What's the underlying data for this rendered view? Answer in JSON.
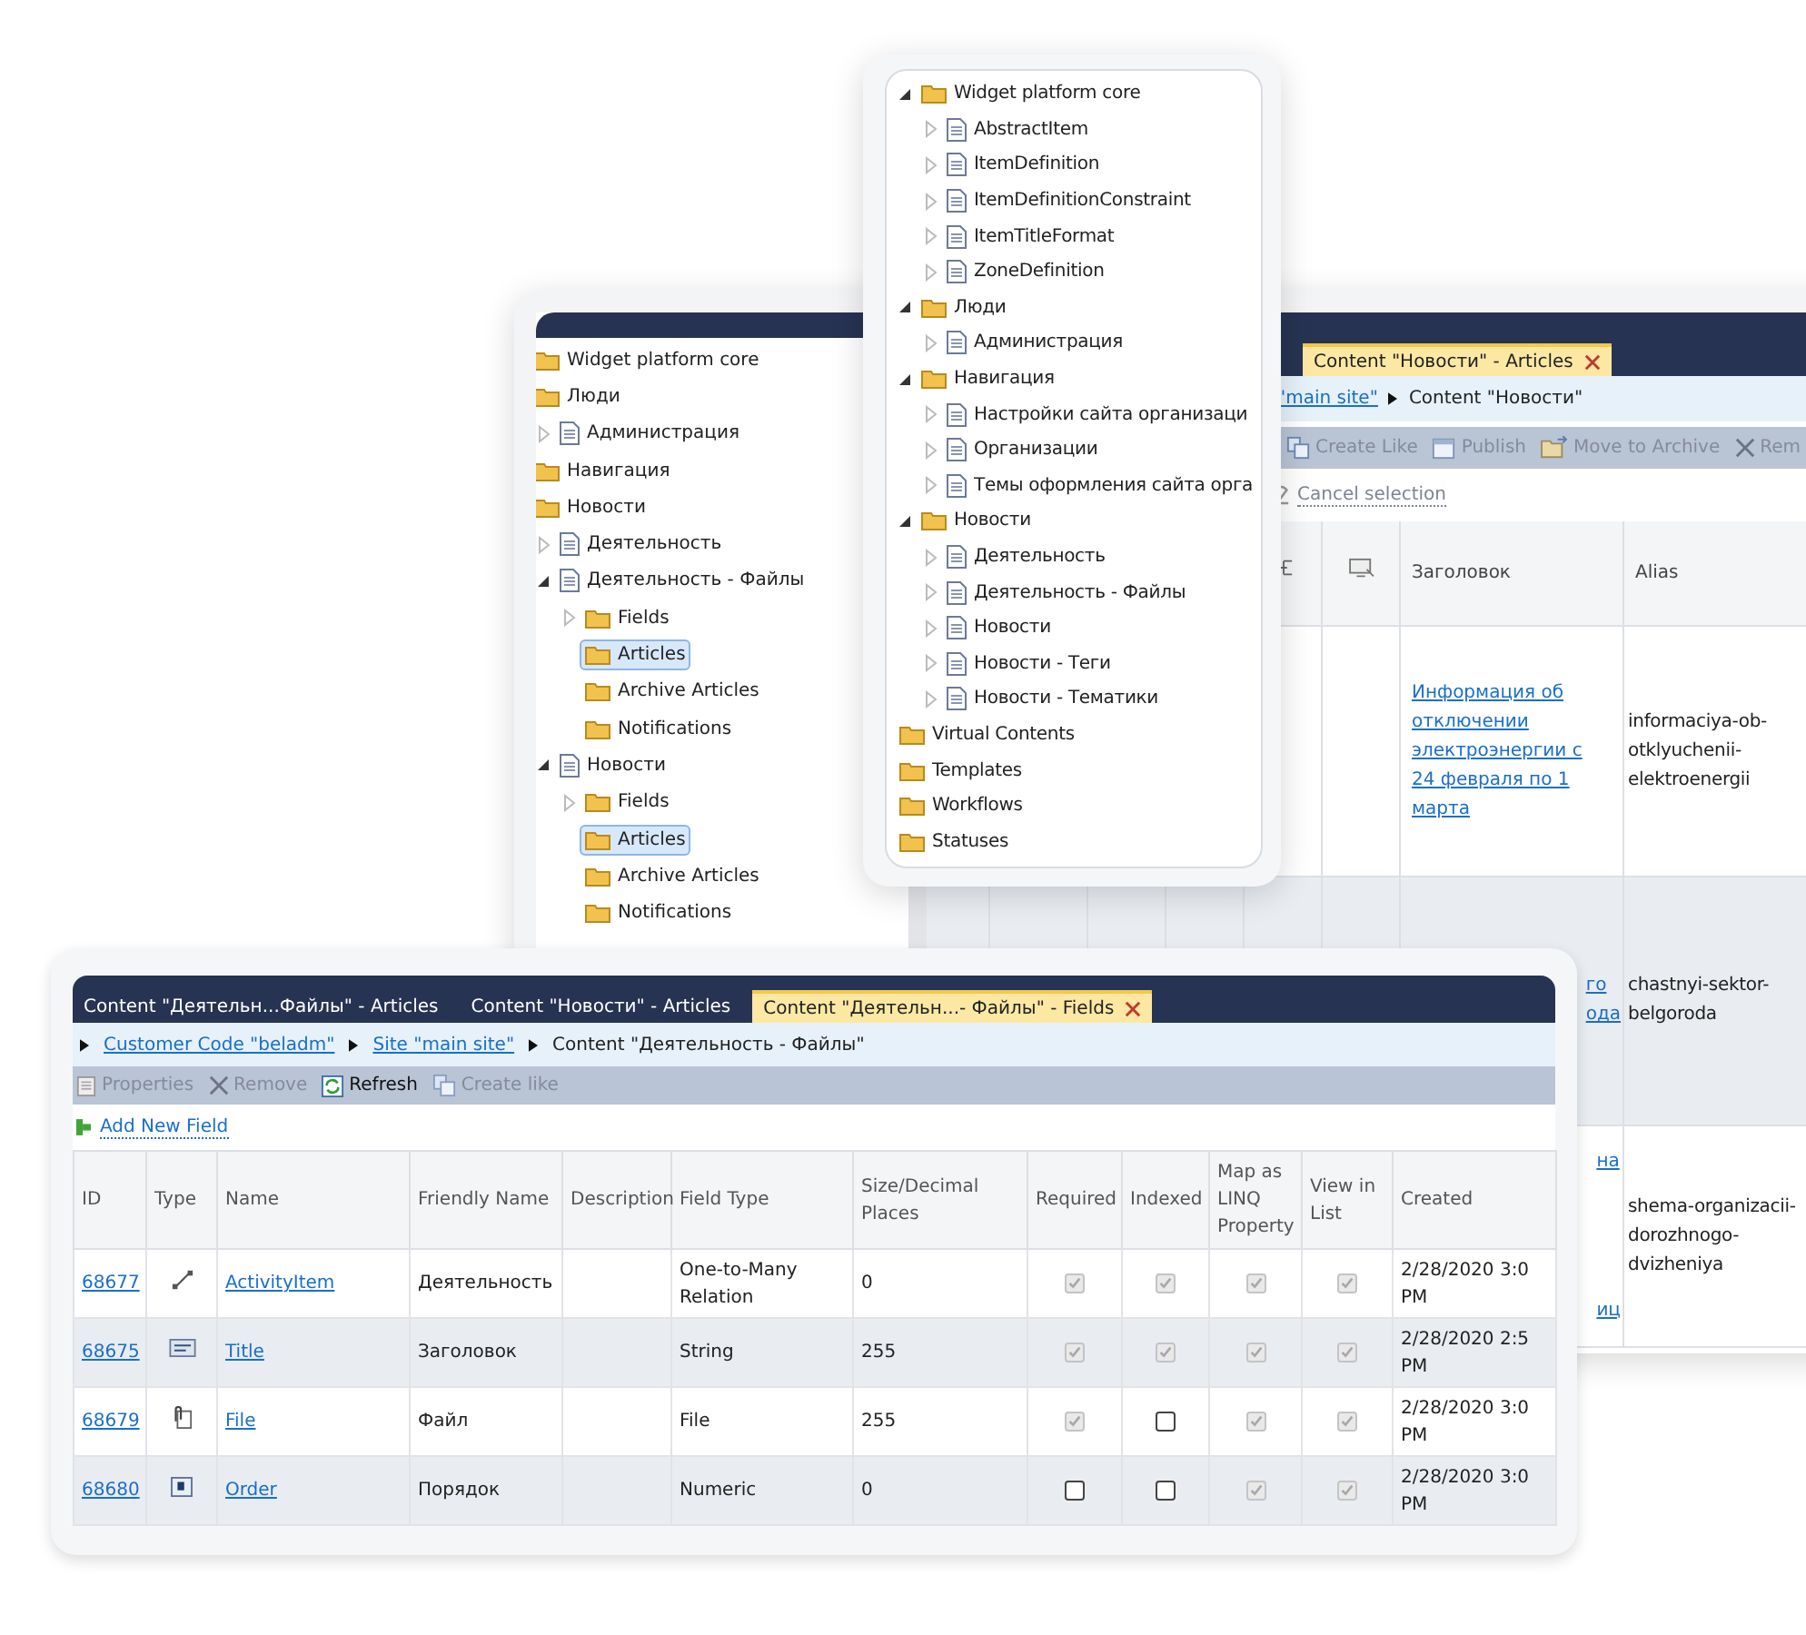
{
  "back_window": {
    "tree": [
      {
        "label": "Widget platform core",
        "kind": "folder",
        "selected": false
      },
      {
        "label": "Люди",
        "kind": "folder",
        "selected": false,
        "children": [
          {
            "label": "Администрация",
            "kind": "doc",
            "expanded": false,
            "selected": false
          }
        ]
      },
      {
        "label": "Навигация",
        "kind": "folder",
        "selected": false
      },
      {
        "label": "Новости",
        "kind": "folder",
        "selected": false,
        "children": [
          {
            "label": "Деятельность",
            "kind": "doc",
            "expanded": false,
            "selected": false
          },
          {
            "label": "Деятельность - Файлы",
            "kind": "doc",
            "expanded": true,
            "selected": false,
            "children": [
              {
                "label": "Fields",
                "kind": "folder",
                "expanded": false,
                "selected": false
              },
              {
                "label": "Articles",
                "kind": "folder",
                "selected": true
              },
              {
                "label": "Archive Articles",
                "kind": "folder",
                "selected": false
              },
              {
                "label": "Notifications",
                "kind": "folder",
                "selected": false
              }
            ]
          },
          {
            "label": "Новости",
            "kind": "doc",
            "expanded": true,
            "selected": false,
            "children": [
              {
                "label": "Fields",
                "kind": "folder",
                "expanded": false,
                "selected": false
              },
              {
                "label": "Articles",
                "kind": "folder",
                "selected": true
              },
              {
                "label": "Archive Articles",
                "kind": "folder",
                "selected": false
              },
              {
                "label": "Notifications",
                "kind": "folder",
                "selected": false
              }
            ]
          }
        ]
      }
    ],
    "tabs": [
      {
        "label": "Content \"Новости\" - Articles",
        "selected": true
      }
    ],
    "breadcrumb": [
      {
        "label": "\"main site\"",
        "link": true
      },
      {
        "label": "Content \"Новости\"",
        "link": false
      }
    ],
    "toolbar": [
      {
        "label": "Create Like",
        "kind": "copy",
        "disabled": true
      },
      {
        "label": "Publish",
        "kind": "publish",
        "disabled": true
      },
      {
        "label": "Move to Archive",
        "kind": "archive",
        "disabled": true
      },
      {
        "label": "Rem",
        "kind": "remove",
        "disabled": true
      }
    ],
    "cancel_selection": "Cancel selection",
    "columns": [
      "Заголовок",
      "Alias"
    ],
    "rows": [
      {
        "title_lines": [
          "Информация об",
          "отключении",
          "электроэнергии с",
          "24 февраля по 1",
          "марта"
        ],
        "alias": "informaciya-ob-otklyuchenii-elektroenergii"
      },
      {
        "title_lines": [
          "го",
          "ода"
        ],
        "alias": "chastnyi-sektor-belgoroda"
      },
      {
        "title_lines": [
          "на",
          "иц"
        ],
        "alias": "shema-organizacii-dorozhnogo-dvizheniya"
      }
    ]
  },
  "tree_popup": {
    "tree": [
      {
        "label": "Widget platform core",
        "kind": "folder",
        "expanded": true,
        "children": [
          {
            "label": "AbstractItem",
            "kind": "doc",
            "expanded": false
          },
          {
            "label": "ItemDefinition",
            "kind": "doc",
            "expanded": false
          },
          {
            "label": "ItemDefinitionConstraint",
            "kind": "doc",
            "expanded": false
          },
          {
            "label": "ItemTitleFormat",
            "kind": "doc",
            "expanded": false
          },
          {
            "label": "ZoneDefinition",
            "kind": "doc",
            "expanded": false
          }
        ]
      },
      {
        "label": "Люди",
        "kind": "folder",
        "expanded": true,
        "children": [
          {
            "label": "Администрация",
            "kind": "doc",
            "expanded": false
          }
        ]
      },
      {
        "label": "Навигация",
        "kind": "folder",
        "expanded": true,
        "children": [
          {
            "label": "Настройки сайта организаци",
            "kind": "doc",
            "expanded": false
          },
          {
            "label": "Организации",
            "kind": "doc",
            "expanded": false
          },
          {
            "label": "Темы оформления сайта орга",
            "kind": "doc",
            "expanded": false
          }
        ]
      },
      {
        "label": "Новости",
        "kind": "folder",
        "expanded": true,
        "children": [
          {
            "label": "Деятельность",
            "kind": "doc",
            "expanded": false
          },
          {
            "label": "Деятельность - Файлы",
            "kind": "doc",
            "expanded": false
          },
          {
            "label": "Новости",
            "kind": "doc",
            "expanded": false
          },
          {
            "label": "Новости - Теги",
            "kind": "doc",
            "expanded": false
          },
          {
            "label": "Новости - Тематики",
            "kind": "doc",
            "expanded": false
          }
        ]
      },
      {
        "label": "Virtual Contents",
        "kind": "folder"
      },
      {
        "label": "Templates",
        "kind": "folder"
      },
      {
        "label": "Workflows",
        "kind": "folder"
      },
      {
        "label": "Statuses",
        "kind": "folder"
      }
    ]
  },
  "front_window": {
    "tabs": [
      {
        "label": "Content \"Деятельн...Файлы\" - Articles",
        "selected": false
      },
      {
        "label": "Content \"Новости\" - Articles",
        "selected": false
      },
      {
        "label": "Content \"Деятельн...- Файлы\" - Fields",
        "selected": true
      }
    ],
    "breadcrumb": [
      {
        "label": "Customer Code \"beladm\"",
        "link": true
      },
      {
        "label": "Site \"main site\"",
        "link": true
      },
      {
        "label": "Content \"Деятельность - Файлы\"",
        "link": false
      }
    ],
    "toolbar": [
      {
        "label": "Properties",
        "kind": "properties",
        "disabled": true
      },
      {
        "label": "Remove",
        "kind": "remove",
        "disabled": true
      },
      {
        "label": "Refresh",
        "kind": "refresh",
        "disabled": false
      },
      {
        "label": "Create like",
        "kind": "copy",
        "disabled": true
      }
    ],
    "add_link": "Add New Field",
    "columns": [
      "ID",
      "Type",
      "Name",
      "Friendly Name",
      "Description",
      "Field Type",
      "Size/Decimal Places",
      "Required",
      "Indexed",
      "Map as LINQ Property",
      "View in List",
      "Created"
    ],
    "rows": [
      {
        "id": "68677",
        "kind": "relation",
        "name": "ActivityItem",
        "friendly_name": "Деятельность",
        "field_type": "One-to-Many Relation",
        "size": "0",
        "required": true,
        "indexed": true,
        "map_linq": true,
        "view_in_list": true,
        "created": "2/28/2020 3:0 PM"
      },
      {
        "id": "68675",
        "kind": "string",
        "name": "Title",
        "friendly_name": "Заголовок",
        "field_type": "String",
        "size": "255",
        "required": true,
        "indexed": true,
        "map_linq": true,
        "view_in_list": true,
        "created": "2/28/2020 2:5 PM"
      },
      {
        "id": "68679",
        "kind": "file",
        "name": "File",
        "friendly_name": "Файл",
        "field_type": "File",
        "size": "255",
        "required": true,
        "indexed": false,
        "map_linq": true,
        "view_in_list": true,
        "created": "2/28/2020 3:0 PM"
      },
      {
        "id": "68680",
        "kind": "numeric",
        "name": "Order",
        "friendly_name": "Порядок",
        "field_type": "Numeric",
        "size": "0",
        "required": false,
        "indexed": false,
        "map_linq": true,
        "view_in_list": true,
        "created": "2/28/2020 3:0 PM"
      }
    ]
  }
}
